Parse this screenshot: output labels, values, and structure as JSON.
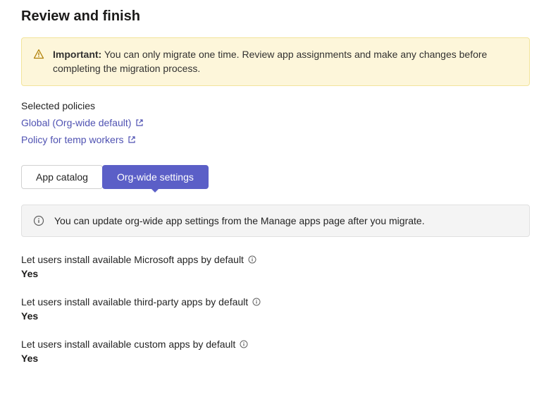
{
  "title": "Review and finish",
  "alert": {
    "strong": "Important:",
    "text": "You can only migrate one time. Review app assignments and make any changes before completing the migration process."
  },
  "selected_policies_label": "Selected policies",
  "policies": [
    {
      "label": "Global (Org-wide default)"
    },
    {
      "label": "Policy for temp workers"
    }
  ],
  "tabs": [
    {
      "label": "App catalog",
      "active": false
    },
    {
      "label": "Org-wide settings",
      "active": true
    }
  ],
  "info_banner": "You can update org-wide app settings from the Manage apps page after you migrate.",
  "settings": [
    {
      "label": "Let users install available Microsoft apps by default",
      "value": "Yes"
    },
    {
      "label": "Let users install available third-party apps by default",
      "value": "Yes"
    },
    {
      "label": "Let users install available custom apps by default",
      "value": "Yes"
    }
  ]
}
